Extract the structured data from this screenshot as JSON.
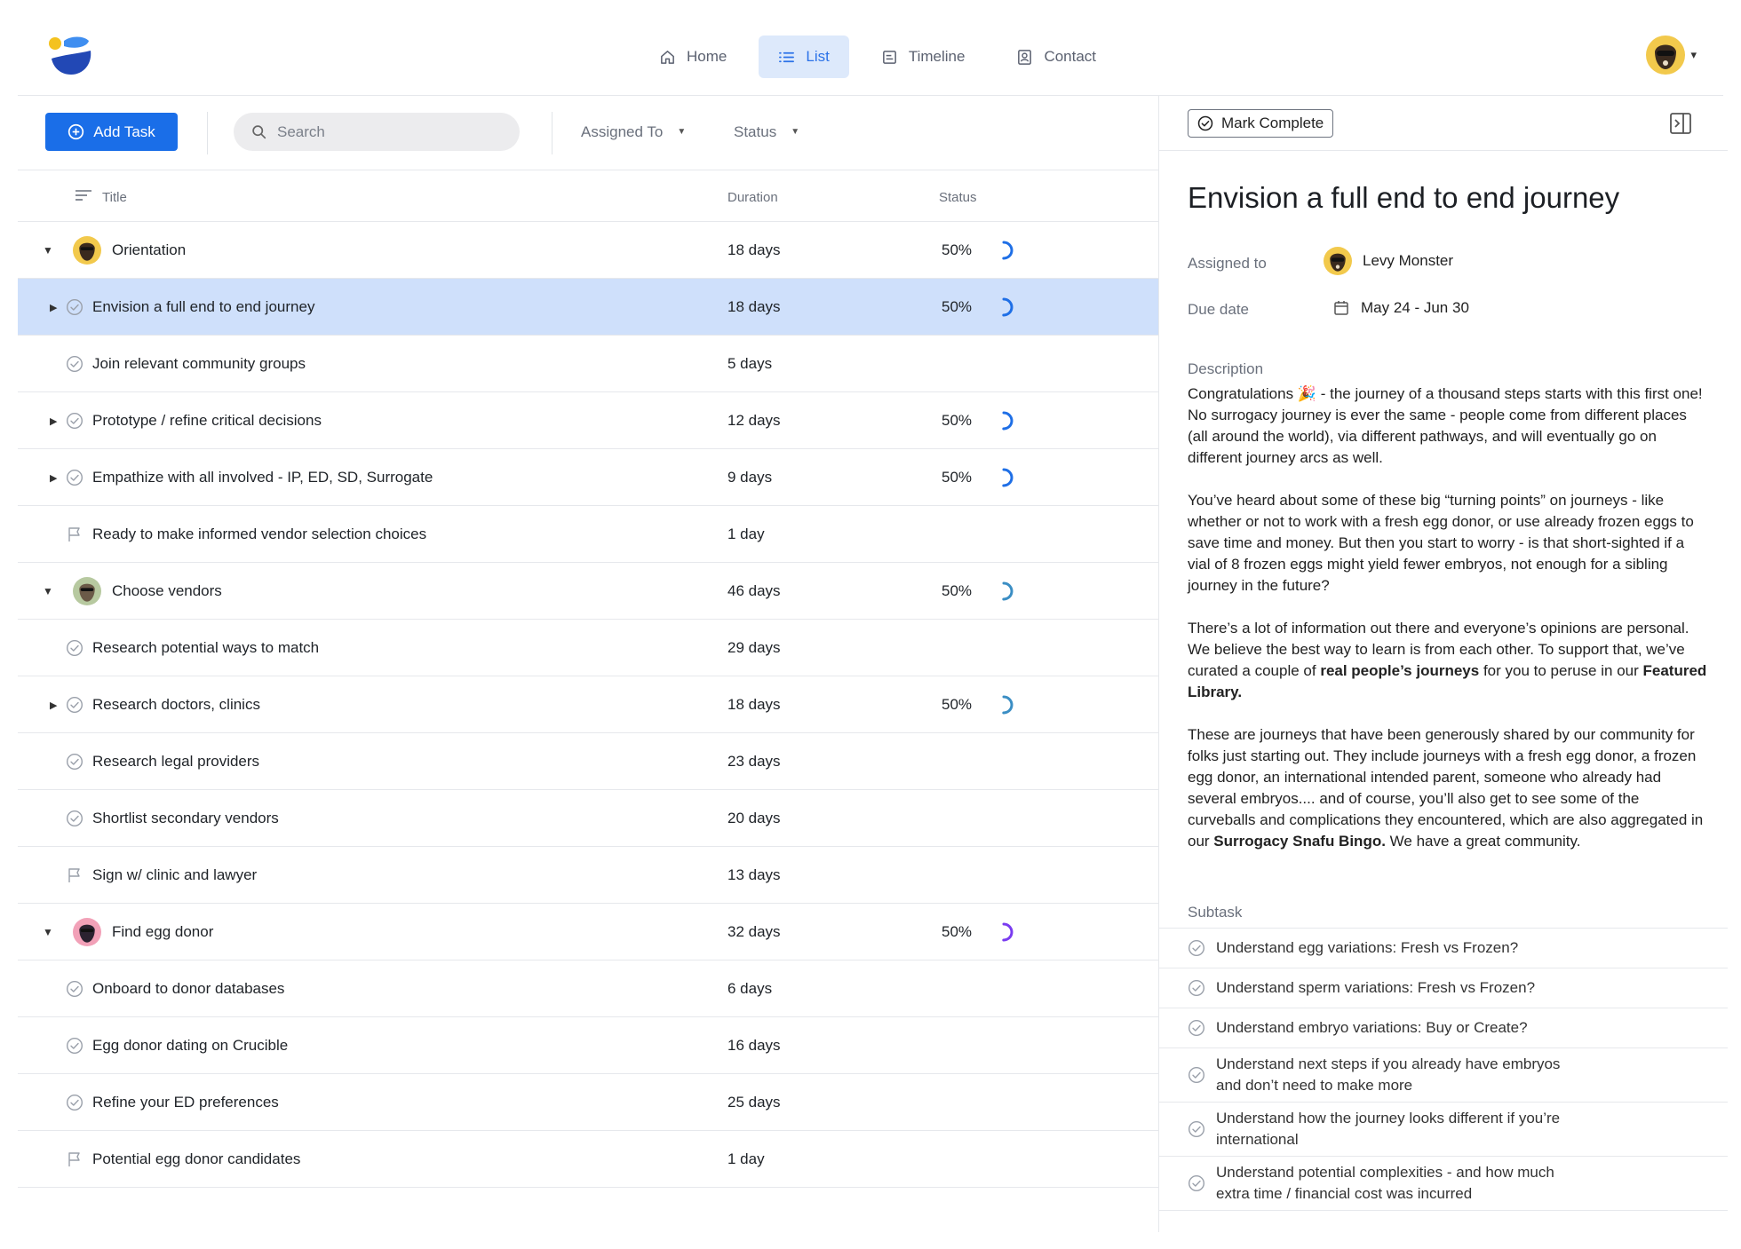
{
  "nav": {
    "items": [
      {
        "label": "Home",
        "icon": "home-icon"
      },
      {
        "label": "List",
        "icon": "list-icon",
        "active": true
      },
      {
        "label": "Timeline",
        "icon": "timeline-icon"
      },
      {
        "label": "Contact",
        "icon": "contact-icon"
      }
    ]
  },
  "toolbar": {
    "add_task_label": "Add Task",
    "search_placeholder": "Search",
    "assigned_to_label": "Assigned To",
    "status_label": "Status"
  },
  "columns": {
    "title": "Title",
    "duration": "Duration",
    "status": "Status"
  },
  "rows": [
    {
      "type": "group",
      "title": "Orientation",
      "duration": "18 days",
      "status": "50%",
      "progress": 0.5,
      "avatar": "yellow"
    },
    {
      "type": "task",
      "title": "Envision a full end to end journey",
      "duration": "18 days",
      "status": "50%",
      "progress": 0.5,
      "expandable": true,
      "selected": true,
      "icon": "check"
    },
    {
      "type": "task",
      "title": "Join relevant community groups",
      "duration": "5 days",
      "status": "",
      "icon": "check"
    },
    {
      "type": "task",
      "title": "Prototype / refine critical decisions",
      "duration": "12 days",
      "status": "50%",
      "progress": 0.5,
      "expandable": true,
      "icon": "check"
    },
    {
      "type": "task",
      "title": "Empathize with all involved - IP, ED, SD, Surrogate",
      "duration": "9 days",
      "status": "50%",
      "progress": 0.5,
      "expandable": true,
      "icon": "check"
    },
    {
      "type": "task",
      "title": "Ready to make informed vendor selection choices",
      "duration": "1 day",
      "status": "",
      "icon": "flag"
    },
    {
      "type": "group",
      "title": "Choose vendors",
      "duration": "46 days",
      "status": "50%",
      "progress": 0.5,
      "avatar": "green"
    },
    {
      "type": "task",
      "title": "Research potential ways to match",
      "duration": "29 days",
      "status": "",
      "icon": "check"
    },
    {
      "type": "task",
      "title": "Research doctors, clinics",
      "duration": "18 days",
      "status": "50%",
      "progress": 0.5,
      "expandable": true,
      "icon": "check"
    },
    {
      "type": "task",
      "title": "Research legal providers",
      "duration": "23 days",
      "status": "",
      "icon": "check"
    },
    {
      "type": "task",
      "title": "Shortlist secondary vendors",
      "duration": "20 days",
      "status": "",
      "icon": "check"
    },
    {
      "type": "task",
      "title": "Sign w/ clinic and lawyer",
      "duration": "13 days",
      "status": "",
      "icon": "flag"
    },
    {
      "type": "group",
      "title": "Find egg donor",
      "duration": "32 days",
      "status": "50%",
      "progress": 0.5,
      "avatar": "pink"
    },
    {
      "type": "task",
      "title": "Onboard to donor databases",
      "duration": "6 days",
      "status": "",
      "icon": "check"
    },
    {
      "type": "task",
      "title": "Egg donor dating on Crucible",
      "duration": "16 days",
      "status": "",
      "icon": "check"
    },
    {
      "type": "task",
      "title": "Refine your ED preferences",
      "duration": "25 days",
      "status": "",
      "icon": "check"
    },
    {
      "type": "task",
      "title": "Potential egg donor candidates",
      "duration": "1 day",
      "status": "",
      "icon": "flag"
    }
  ],
  "detail": {
    "mark_complete_label": "Mark Complete",
    "title": "Envision a full end to end journey",
    "assigned_label": "Assigned to",
    "assigned_value": "Levy Monster",
    "due_label": "Due date",
    "due_value": "May 24 - Jun 30",
    "description_label": "Description",
    "description": {
      "p1_a": "Congratulations ",
      "p1_emoji": "🎉",
      "p1_b": " - the journey of a thousand steps starts with this first one! No surrogacy journey is ever the same - people come from different places (all around the world), via different pathways, and will eventually go on different journey arcs as well.",
      "p2": "You’ve heard about some of these big “turning points” on journeys - like whether or not to work with a fresh egg donor, or use already frozen eggs to save time and money. But then you start to worry - is that short-sighted if a vial of 8 frozen eggs might yield fewer embryos, not enough for a sibling journey in the future?",
      "p3_a": "There’s a lot of information out there and everyone’s opinions are personal. We believe the best way to learn is from each other. To support that, we’ve curated a couple of ",
      "p3_b": "real people’s journeys",
      "p3_c": " for you to peruse in our ",
      "p3_d": "Featured Library.",
      "p4_a": "These are journeys that have been generously shared by our community for folks just starting out. They include journeys with a fresh egg donor, a frozen egg donor, an international intended parent, someone who already had several embryos.... and of course, you’ll also get to see some of the curveballs and complications they encountered, which are also aggregated in our ",
      "p4_b": "Surrogacy Snafu Bingo.",
      "p4_c": " We have a great community."
    },
    "subtask_label": "Subtask",
    "subtasks": [
      "Understand egg variations: Fresh vs Frozen?",
      "Understand sperm variations: Fresh vs Frozen?",
      "Understand embryo variations: Buy or Create?",
      "Understand next steps if you already have embryos and don’t need to make more",
      "Understand how the journey looks different if you’re international",
      "Understand potential complexities - and how much extra time / financial cost was incurred"
    ]
  },
  "colors": {
    "accent": "#1a6ee8",
    "selected_row": "#cfe0fb",
    "nav_active_bg": "#dde9fb",
    "ring_blue": "#1f6fe6",
    "ring_teal": "#3b8ec4",
    "ring_purple": "#7a3cf0"
  }
}
